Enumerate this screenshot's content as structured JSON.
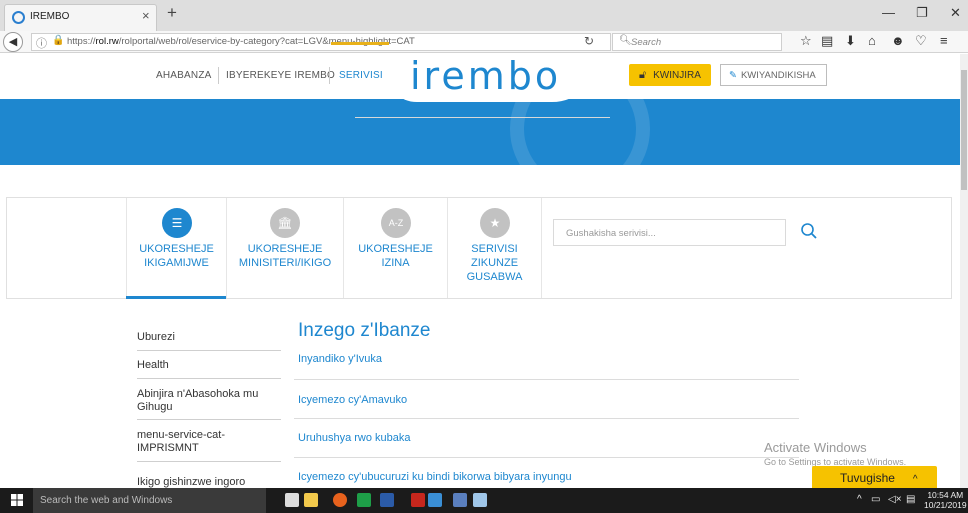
{
  "browser": {
    "tab_title": "IREMBO",
    "tab_close": "×",
    "new_tab": "+",
    "url_prefix": "https://",
    "url_domain": "rol.rw",
    "url_rest": "/rolportal/web/rol/eservice-by-category?cat=LGV&menu-highlight=CAT",
    "search_placeholder": "Search"
  },
  "header": {
    "nav": [
      "AHABANZA",
      "IBYEREKEYE IREMBO",
      "SERIVISI K"
    ],
    "logo": "irembo",
    "login_label": "KWINJIRA",
    "register_label": "KWIYANDIKISHA"
  },
  "categories": [
    {
      "label": "UKORESHEJE IKIGAMIJWE",
      "icon": "list-icon",
      "color": "#1e87cf",
      "active": true
    },
    {
      "label": "UKORESHEJE MINISITERI/IKIGO",
      "icon": "building-icon",
      "color": "#c2c2c2",
      "active": false
    },
    {
      "label": "UKORESHEJE IZINA",
      "icon": "az-icon",
      "glyph": "A-Z",
      "color": "#c2c2c2",
      "active": false
    },
    {
      "label": "SERIVISI ZIKUNZE GUSABWA",
      "icon": "star-icon",
      "color": "#c2c2c2",
      "active": false
    }
  ],
  "service_search": {
    "placeholder": "Gushakisha serivisi..."
  },
  "sidebar": {
    "items": [
      "Uburezi",
      "Health",
      "Abinjira n'Abasohoka mu Gihugu",
      "menu-service-cat-IMPRISMNT",
      "Ikigo gishinzwe ingoro"
    ]
  },
  "main": {
    "section_title": "Inzego z'Ibanze",
    "services": [
      "Inyandiko y'Ivuka",
      "Icyemezo cy'Amavuko",
      "Uruhushya rwo kubaka",
      "Icyemezo cy'ubucuruzi ku bindi bikorwa bibyara inyungu"
    ]
  },
  "watermark": {
    "line1": "Activate Windows",
    "line2": "Go to Settings to activate Windows."
  },
  "help": {
    "label": "Tuvugishe",
    "caret": "^"
  },
  "taskbar": {
    "search_placeholder": "Search the web and Windows",
    "time": "10:54 AM",
    "date": "10/21/2019"
  },
  "colors": {
    "brand_blue": "#1e87cf",
    "brand_yellow": "#f6c200"
  }
}
